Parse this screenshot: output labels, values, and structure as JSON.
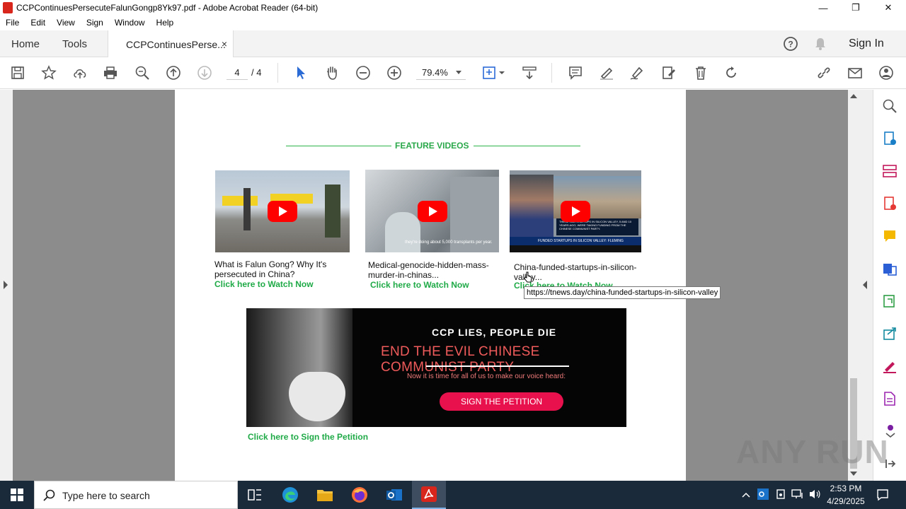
{
  "window": {
    "title": "CCPContinuesPersecuteFalunGongp8Yk97.pdf - Adobe Acrobat Reader (64-bit)",
    "minimize": "—",
    "restore": "❐",
    "close": "✕"
  },
  "menu": [
    "File",
    "Edit",
    "View",
    "Sign",
    "Window",
    "Help"
  ],
  "tabs": {
    "home": "Home",
    "tools": "Tools",
    "doc": "CCPContinuesPerse...",
    "close": "×",
    "sign_in": "Sign In"
  },
  "toolbar": {
    "page_current": "4",
    "page_total": "/  4",
    "zoom": "79.4%"
  },
  "document": {
    "feature_title": "FEATURE VIDEOS",
    "videos": [
      {
        "title": "What is Falun Gong? Why It's persecuted in China?",
        "link": "Click here to Watch Now"
      },
      {
        "title": "Medical-genocide-hidden-mass-murder-in-chinas...",
        "link": "Click here to Watch Now",
        "caption": "they're doing about 5,000 transplants per year."
      },
      {
        "title": "China-funded-startups-in-silicon-valley...",
        "link": "Click here to Watch Now",
        "caption": "FUNDED STARTUPS IN SILICON VALLEY: FLEMING",
        "overlay": "THESE RAN STARTUPS IN SILICON VALLEY, 5 AND 10 YEARS AGO, WERE TAKING FUNDING FROM THE CHINESE COMMUNIST PARTY."
      }
    ],
    "tooltip": "https://tnews.day/china-funded-startups-in-silicon-valley",
    "banner": {
      "line1": "CCP LIES, PEOPLE DIE",
      "line2": "END THE EVIL CHINESE COMMUNIST PARTY",
      "line3": "Now it is time for all of us to make our voice heard:",
      "cta": "SIGN THE PETITION"
    },
    "petition_link": "Click here to Sign the Petition"
  },
  "taskbar": {
    "search_placeholder": "Type here to search",
    "time": "2:53 PM",
    "date": "4/29/2025"
  },
  "watermark": "ANY RUN",
  "colors": {
    "accent_green": "#1faa47",
    "acrobat_red": "#d9261c",
    "taskbar": "#1b2a3a",
    "petition_pink": "#e8114e"
  }
}
